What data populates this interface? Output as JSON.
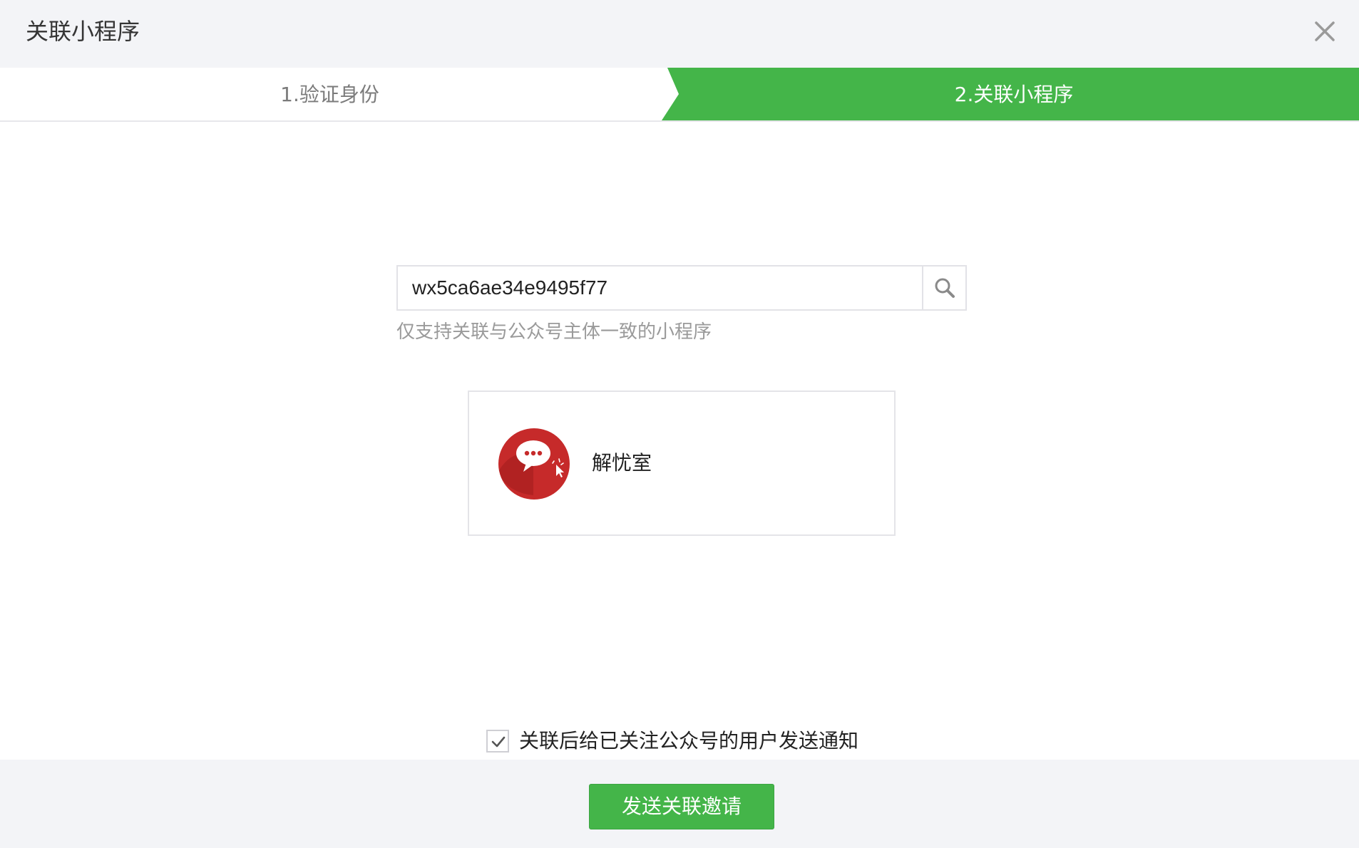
{
  "dialog": {
    "title": "关联小程序"
  },
  "steps": [
    {
      "label": "1.验证身份",
      "state": "done"
    },
    {
      "label": "2.关联小程序",
      "state": "active"
    }
  ],
  "search": {
    "value": "wx5ca6ae34e9495f77",
    "hint": "仅支持关联与公众号主体一致的小程序"
  },
  "result": {
    "app_name": "解忧室",
    "icon": "speech-bubble-icon"
  },
  "notify": {
    "checked": true,
    "label": "关联后给已关注公众号的用户发送通知"
  },
  "footer": {
    "send_label": "发送关联邀请"
  },
  "colors": {
    "accent": "#44b549",
    "header_bg": "#f3f4f7",
    "avatar_red": "#c62a2a"
  }
}
